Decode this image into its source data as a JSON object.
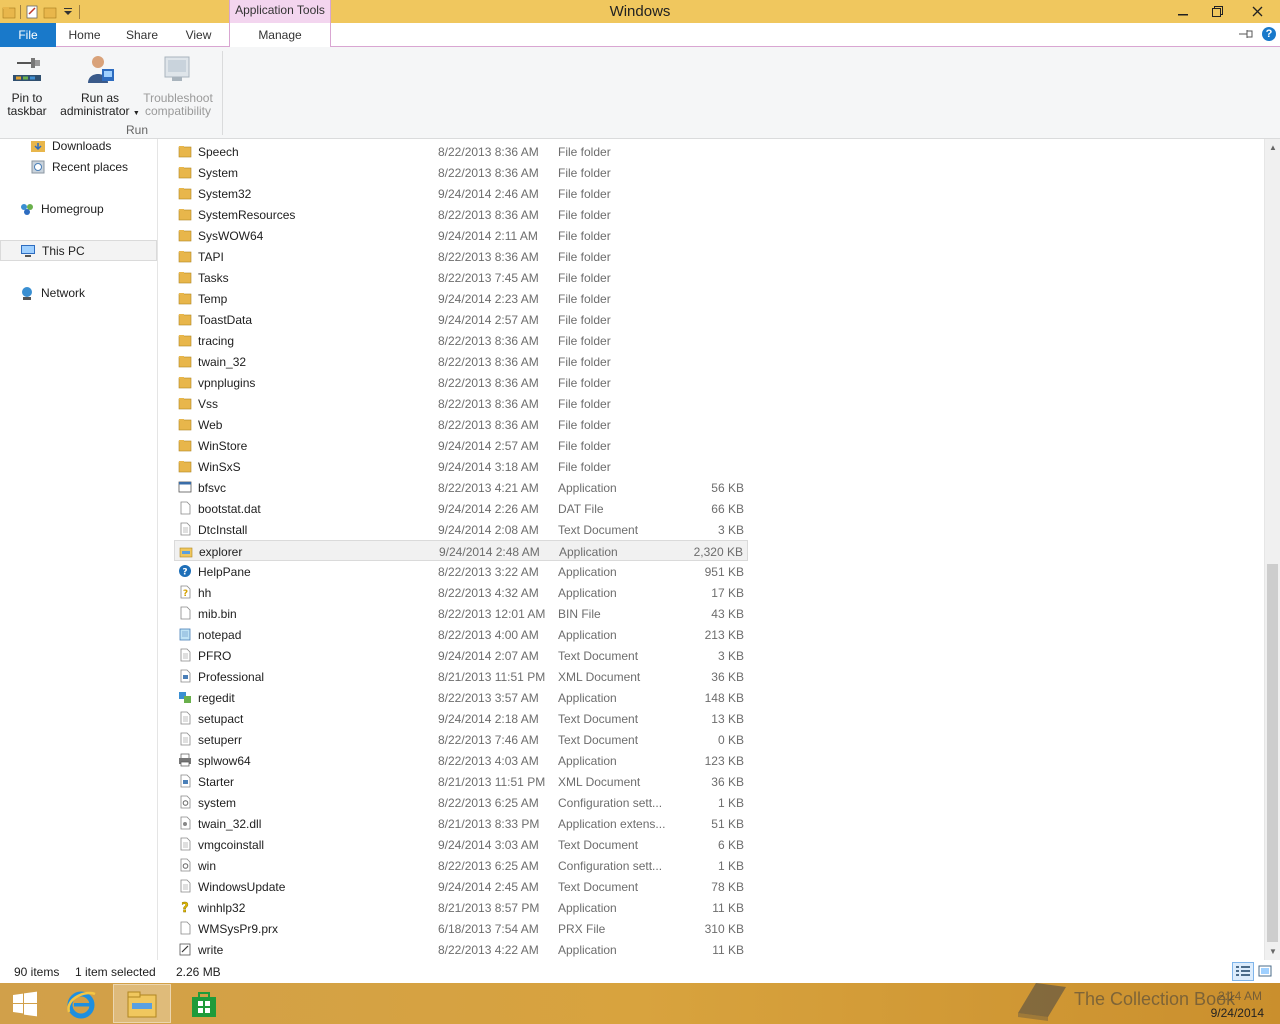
{
  "window": {
    "title": "Windows",
    "context_tab_header": "Application Tools"
  },
  "ribbon": {
    "tabs": {
      "file": "File",
      "home": "Home",
      "share": "Share",
      "view": "View",
      "manage": "Manage"
    },
    "buttons": {
      "pin_line1": "Pin to",
      "pin_line2": "taskbar",
      "admin_line1": "Run as",
      "admin_line2": "administrator",
      "trouble_line1": "Troubleshoot",
      "trouble_line2": "compatibility"
    },
    "group_label": "Run"
  },
  "nav": {
    "downloads": "Downloads",
    "recent": "Recent places",
    "homegroup": "Homegroup",
    "thispc": "This PC",
    "network": "Network"
  },
  "files": [
    {
      "name": "Speech",
      "date": "8/22/2013 8:36 AM",
      "type": "File folder",
      "size": "",
      "icon": "folder-icon"
    },
    {
      "name": "System",
      "date": "8/22/2013 8:36 AM",
      "type": "File folder",
      "size": "",
      "icon": "folder-icon"
    },
    {
      "name": "System32",
      "date": "9/24/2014 2:46 AM",
      "type": "File folder",
      "size": "",
      "icon": "folder-icon"
    },
    {
      "name": "SystemResources",
      "date": "8/22/2013 8:36 AM",
      "type": "File folder",
      "size": "",
      "icon": "folder-icon"
    },
    {
      "name": "SysWOW64",
      "date": "9/24/2014 2:11 AM",
      "type": "File folder",
      "size": "",
      "icon": "folder-icon"
    },
    {
      "name": "TAPI",
      "date": "8/22/2013 8:36 AM",
      "type": "File folder",
      "size": "",
      "icon": "folder-icon"
    },
    {
      "name": "Tasks",
      "date": "8/22/2013 7:45 AM",
      "type": "File folder",
      "size": "",
      "icon": "folder-icon"
    },
    {
      "name": "Temp",
      "date": "9/24/2014 2:23 AM",
      "type": "File folder",
      "size": "",
      "icon": "folder-icon"
    },
    {
      "name": "ToastData",
      "date": "9/24/2014 2:57 AM",
      "type": "File folder",
      "size": "",
      "icon": "folder-icon"
    },
    {
      "name": "tracing",
      "date": "8/22/2013 8:36 AM",
      "type": "File folder",
      "size": "",
      "icon": "folder-icon"
    },
    {
      "name": "twain_32",
      "date": "8/22/2013 8:36 AM",
      "type": "File folder",
      "size": "",
      "icon": "folder-icon"
    },
    {
      "name": "vpnplugins",
      "date": "8/22/2013 8:36 AM",
      "type": "File folder",
      "size": "",
      "icon": "folder-icon"
    },
    {
      "name": "Vss",
      "date": "8/22/2013 8:36 AM",
      "type": "File folder",
      "size": "",
      "icon": "folder-icon"
    },
    {
      "name": "Web",
      "date": "8/22/2013 8:36 AM",
      "type": "File folder",
      "size": "",
      "icon": "folder-icon"
    },
    {
      "name": "WinStore",
      "date": "9/24/2014 2:57 AM",
      "type": "File folder",
      "size": "",
      "icon": "folder-icon"
    },
    {
      "name": "WinSxS",
      "date": "9/24/2014 3:18 AM",
      "type": "File folder",
      "size": "",
      "icon": "folder-icon"
    },
    {
      "name": "bfsvc",
      "date": "8/22/2013 4:21 AM",
      "type": "Application",
      "size": "56 KB",
      "icon": "app-icon"
    },
    {
      "name": "bootstat.dat",
      "date": "9/24/2014 2:26 AM",
      "type": "DAT File",
      "size": "66 KB",
      "icon": "file-icon"
    },
    {
      "name": "DtcInstall",
      "date": "9/24/2014 2:08 AM",
      "type": "Text Document",
      "size": "3 KB",
      "icon": "text-file-icon"
    },
    {
      "name": "explorer",
      "date": "9/24/2014 2:48 AM",
      "type": "Application",
      "size": "2,320 KB",
      "icon": "explorer-icon",
      "selected": true
    },
    {
      "name": "HelpPane",
      "date": "8/22/2013 3:22 AM",
      "type": "Application",
      "size": "951 KB",
      "icon": "help-icon"
    },
    {
      "name": "hh",
      "date": "8/22/2013 4:32 AM",
      "type": "Application",
      "size": "17 KB",
      "icon": "help-file-icon"
    },
    {
      "name": "mib.bin",
      "date": "8/22/2013 12:01 AM",
      "type": "BIN File",
      "size": "43 KB",
      "icon": "file-icon"
    },
    {
      "name": "notepad",
      "date": "8/22/2013 4:00 AM",
      "type": "Application",
      "size": "213 KB",
      "icon": "notepad-icon"
    },
    {
      "name": "PFRO",
      "date": "9/24/2014 2:07 AM",
      "type": "Text Document",
      "size": "3 KB",
      "icon": "text-file-icon"
    },
    {
      "name": "Professional",
      "date": "8/21/2013 11:51 PM",
      "type": "XML Document",
      "size": "36 KB",
      "icon": "xml-file-icon"
    },
    {
      "name": "regedit",
      "date": "8/22/2013 3:57 AM",
      "type": "Application",
      "size": "148 KB",
      "icon": "regedit-icon"
    },
    {
      "name": "setupact",
      "date": "9/24/2014 2:18 AM",
      "type": "Text Document",
      "size": "13 KB",
      "icon": "text-file-icon"
    },
    {
      "name": "setuperr",
      "date": "8/22/2013 7:46 AM",
      "type": "Text Document",
      "size": "0 KB",
      "icon": "text-file-icon"
    },
    {
      "name": "splwow64",
      "date": "8/22/2013 4:03 AM",
      "type": "Application",
      "size": "123 KB",
      "icon": "printer-icon"
    },
    {
      "name": "Starter",
      "date": "8/21/2013 11:51 PM",
      "type": "XML Document",
      "size": "36 KB",
      "icon": "xml-file-icon"
    },
    {
      "name": "system",
      "date": "8/22/2013 6:25 AM",
      "type": "Configuration sett...",
      "size": "1 KB",
      "icon": "config-file-icon"
    },
    {
      "name": "twain_32.dll",
      "date": "8/21/2013 8:33 PM",
      "type": "Application extens...",
      "size": "51 KB",
      "icon": "dll-file-icon"
    },
    {
      "name": "vmgcoinstall",
      "date": "9/24/2014 3:03 AM",
      "type": "Text Document",
      "size": "6 KB",
      "icon": "text-file-icon"
    },
    {
      "name": "win",
      "date": "8/22/2013 6:25 AM",
      "type": "Configuration sett...",
      "size": "1 KB",
      "icon": "config-file-icon"
    },
    {
      "name": "WindowsUpdate",
      "date": "9/24/2014 2:45 AM",
      "type": "Text Document",
      "size": "78 KB",
      "icon": "text-file-icon"
    },
    {
      "name": "winhlp32",
      "date": "8/21/2013 8:57 PM",
      "type": "Application",
      "size": "11 KB",
      "icon": "help-question-icon"
    },
    {
      "name": "WMSysPr9.prx",
      "date": "6/18/2013 7:54 AM",
      "type": "PRX File",
      "size": "310 KB",
      "icon": "file-icon"
    },
    {
      "name": "write",
      "date": "8/22/2013 4:22 AM",
      "type": "Application",
      "size": "11 KB",
      "icon": "write-icon"
    }
  ],
  "status": {
    "count": "90 items",
    "selected": "1 item selected",
    "size": "2.26 MB"
  },
  "tray": {
    "watermark": "The Collection Book",
    "time": "2:14 AM",
    "date": "9/24/2014"
  },
  "colors": {
    "titlebar": "#f0c75e",
    "context_tab": "#f3d5ef",
    "file_tab": "#1979ca",
    "taskbar": "#d8a33e"
  }
}
